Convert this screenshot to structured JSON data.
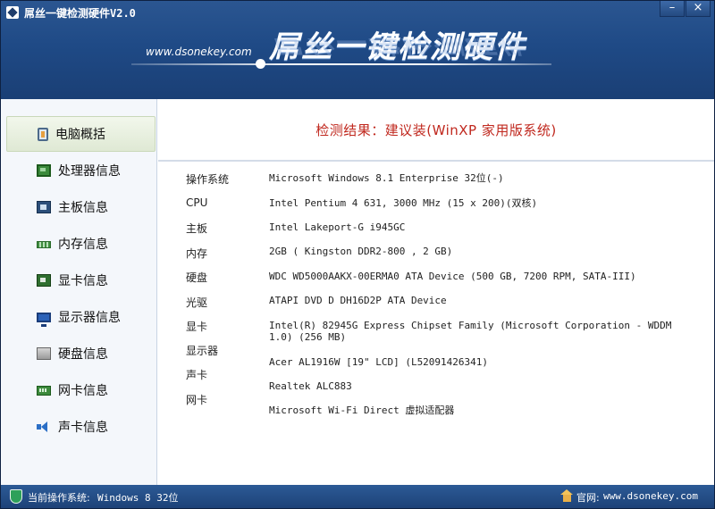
{
  "window": {
    "title": "屌丝一键检测硬件V2.0",
    "controls": {
      "minimize": "–",
      "close": "×"
    }
  },
  "banner": {
    "site_url": "www.dsonekey.com",
    "title": "屌丝一键检测硬件"
  },
  "sidebar": {
    "items": [
      {
        "label": "电脑概括",
        "icon": "computer-icon",
        "active": true
      },
      {
        "label": "处理器信息",
        "icon": "cpu-icon",
        "active": false
      },
      {
        "label": "主板信息",
        "icon": "motherboard-icon",
        "active": false
      },
      {
        "label": "内存信息",
        "icon": "memory-icon",
        "active": false
      },
      {
        "label": "显卡信息",
        "icon": "graphics-card-icon",
        "active": false
      },
      {
        "label": "显示器信息",
        "icon": "monitor-icon",
        "active": false
      },
      {
        "label": "硬盘信息",
        "icon": "hard-disk-icon",
        "active": false
      },
      {
        "label": "网卡信息",
        "icon": "network-card-icon",
        "active": false
      },
      {
        "label": "声卡信息",
        "icon": "speaker-icon",
        "active": false
      }
    ]
  },
  "content": {
    "result": "检测结果：建议装(WinXP 家用版系统)",
    "labels": [
      "操作系统",
      "CPU",
      "主板",
      "内存",
      "硬盘",
      "光驱",
      "显卡",
      "显示器",
      "声卡",
      "网卡"
    ],
    "values": [
      "Microsoft Windows 8.1 Enterprise 32位(-)",
      "Intel Pentium 4 631, 3000 MHz (15 x 200)(双核)",
      "Intel Lakeport-G i945GC",
      "2GB ( Kingston  DDR2-800  , 2 GB)",
      "WDC WD5000AAKX-00ERMA0 ATA Device (500 GB, 7200 RPM, SATA-III)",
      "ATAPI DVD D DH16D2P ATA Device",
      "Intel(R) 82945G Express Chipset Family (Microsoft Corporation - WDDM 1.0) (256 MB)",
      "Acer AL1916W [19\" LCD] (L52091426341)",
      "Realtek ALC883",
      "Microsoft Wi-Fi Direct 虚拟适配器"
    ]
  },
  "statusbar": {
    "os_label": "当前操作系统:",
    "os_value": "Windows 8 32位",
    "site_label": "官网:",
    "site_link": "www.dsonekey.com"
  },
  "colors": {
    "frame": "#1f3d6b",
    "result_text": "#c0281e",
    "active_nav": "#dfe9d4"
  }
}
